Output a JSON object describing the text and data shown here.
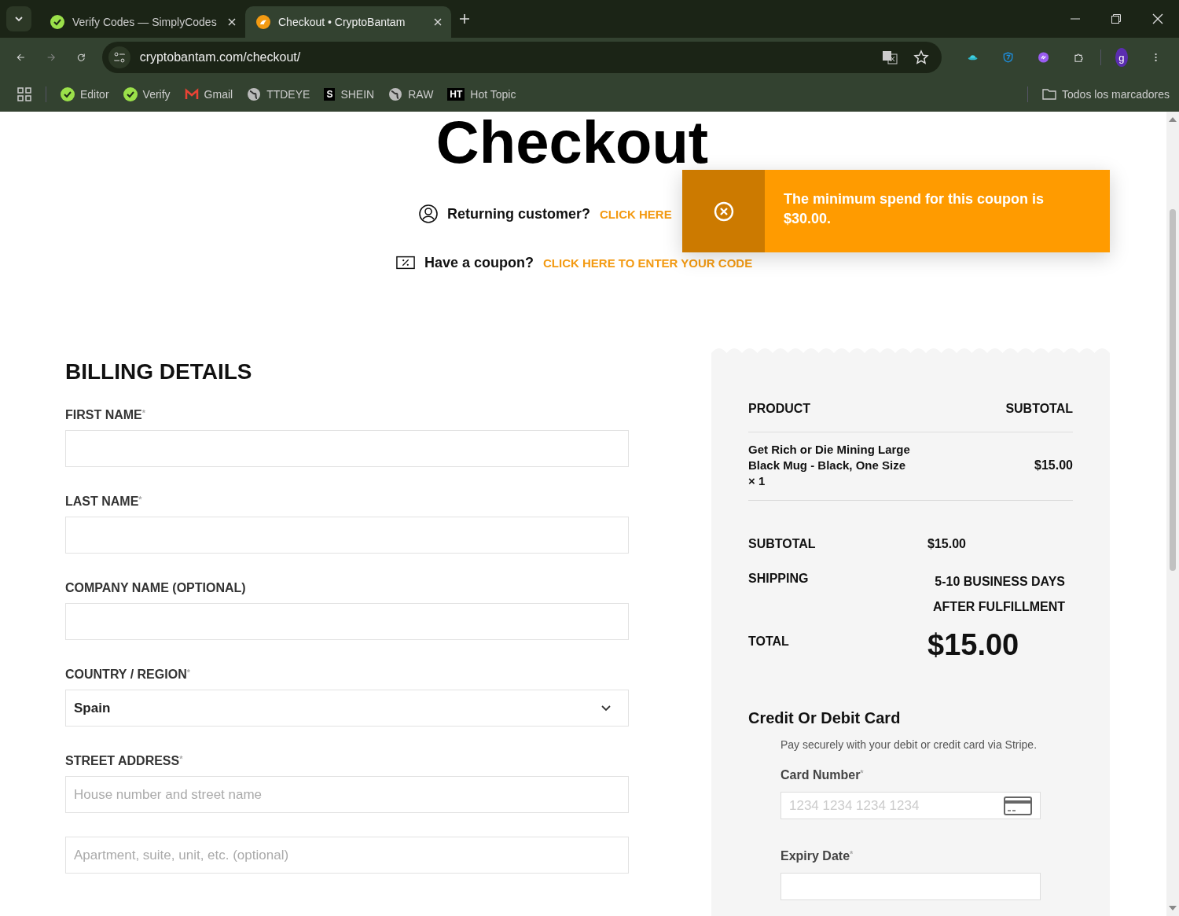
{
  "browser": {
    "tabs": [
      {
        "title": "Verify Codes — SimplyCodes",
        "selected": false
      },
      {
        "title": "Checkout • CryptoBantam",
        "selected": true
      }
    ],
    "address": "cryptobantam.com/checkout/",
    "bookmarks": [
      {
        "label": "Editor"
      },
      {
        "label": "Verify"
      },
      {
        "label": "Gmail"
      },
      {
        "label": "TTDEYE"
      },
      {
        "label": "SHEIN",
        "letter": "S"
      },
      {
        "label": "RAW"
      },
      {
        "label": "Hot Topic",
        "letter": "HT"
      }
    ],
    "all_bookmarks": "Todos los marcadores",
    "profile": "g"
  },
  "page": {
    "title": "Checkout",
    "returning": {
      "text": "Returning customer?",
      "link": "CLICK HERE"
    },
    "coupon": {
      "text": "Have a coupon?",
      "link": "CLICK HERE TO ENTER YOUR CODE"
    },
    "toast": {
      "message": "The minimum spend for this coupon is $30.00."
    },
    "billing": {
      "heading": "BILLING DETAILS",
      "fields": [
        {
          "kind": "text",
          "label": "FIRST NAME",
          "mark": "*"
        },
        {
          "kind": "text",
          "label": "LAST NAME",
          "mark": "*"
        },
        {
          "kind": "text",
          "label": "COMPANY NAME (OPTIONAL)"
        },
        {
          "kind": "select",
          "label": "COUNTRY / REGION",
          "mark": "*",
          "value": "Spain"
        },
        {
          "kind": "text",
          "label": "STREET ADDRESS",
          "mark": "*",
          "placeholder": "House number and street name"
        },
        {
          "kind": "text",
          "placeholder": "Apartment, suite, unit, etc. (optional)"
        }
      ]
    },
    "order": {
      "columns": [
        "PRODUCT",
        "SUBTOTAL"
      ],
      "items": [
        {
          "name": "Get Rich or Die Mining Large Black Mug - Black, One Size",
          "qty": "× 1",
          "price": "$15.00"
        }
      ],
      "subtotal": {
        "label": "SUBTOTAL",
        "value": "$15.00"
      },
      "shipping": {
        "label": "SHIPPING",
        "lines": [
          "5-10 BUSINESS DAYS",
          "AFTER FULFILLMENT"
        ]
      },
      "total": {
        "label": "TOTAL",
        "value": "$15.00"
      },
      "payment": {
        "heading": "Credit Or Debit Card",
        "note": "Pay securely with your debit or credit card via Stripe.",
        "card_label": "Card Number",
        "card_mark": "*",
        "card_placeholder": "1234 1234 1234 1234",
        "expiry_label": "Expiry Date",
        "expiry_mark": "*"
      }
    }
  }
}
